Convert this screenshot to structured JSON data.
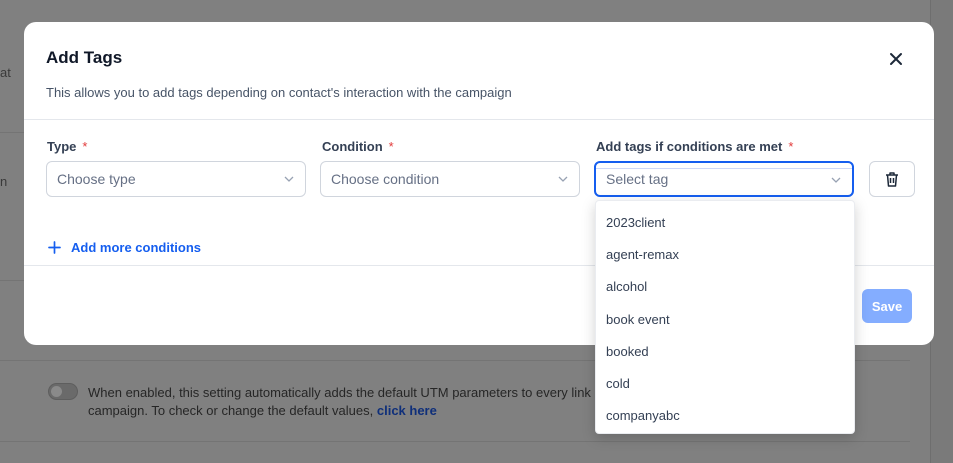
{
  "background": {
    "edge_text_1": "at",
    "edge_text_2": "n",
    "utm_text": "When enabled, this setting automatically adds the default UTM parameters to every link in t",
    "utm_text_2": "campaign. To check or change the default values,",
    "utm_link": "click here"
  },
  "modal": {
    "title": "Add Tags",
    "subtitle": "This allows you to add tags depending on contact's interaction with the campaign",
    "close_icon": "close-icon",
    "fields": {
      "type_label": "Type",
      "type_placeholder": "Choose type",
      "condition_label": "Condition",
      "condition_placeholder": "Choose condition",
      "tags_label": "Add tags if conditions are met",
      "tags_placeholder": "Select tag",
      "required_mark": "*"
    },
    "add_more_label": "Add more conditions",
    "save_label": "Save"
  },
  "dropdown": {
    "options": [
      "2023client",
      "agent-remax",
      "alcohol",
      "book event",
      "booked",
      "cold",
      "companyabc"
    ]
  },
  "colors": {
    "accent": "#155eef",
    "save_disabled": "#84adff",
    "required": "#e23a3a"
  }
}
